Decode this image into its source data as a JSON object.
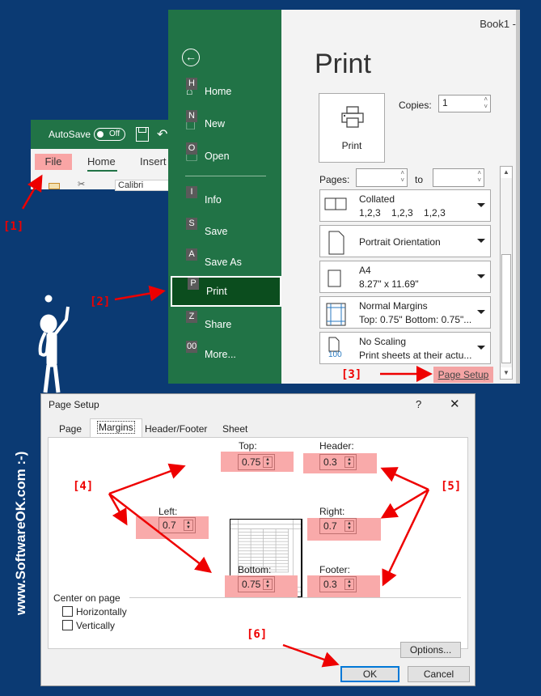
{
  "ribbon": {
    "autosave_label": "AutoSave",
    "autosave_state": "Off",
    "tabs": [
      "File",
      "Home",
      "Insert"
    ],
    "font_name": "Calibri"
  },
  "backstage": {
    "back_icon": "back-arrow-icon",
    "nav": [
      {
        "key": "H",
        "label": "Home",
        "icon": "home-icon"
      },
      {
        "key": "N",
        "label": "New",
        "icon": "new-document-icon"
      },
      {
        "key": "O",
        "label": "Open",
        "icon": "folder-icon"
      },
      {
        "key": "I",
        "label": "Info"
      },
      {
        "key": "S",
        "label": "Save"
      },
      {
        "key": "A",
        "label": "Save As"
      },
      {
        "key": "P",
        "label": "Print",
        "active": true
      },
      {
        "key": "Z",
        "label": "Share"
      },
      {
        "key": "00",
        "label": "More..."
      }
    ]
  },
  "print": {
    "window_title": "Book1 -",
    "title": "Print",
    "print_button": "Print",
    "copies_label": "Copies:",
    "copies_value": "1",
    "pages_label": "Pages:",
    "pages_from": "",
    "to_label": "to",
    "pages_to": "",
    "options": [
      {
        "line1": "Collated",
        "line2": "1,2,3    1,2,3    1,2,3"
      },
      {
        "line1": "Portrait Orientation",
        "line2": ""
      },
      {
        "line1": "A4",
        "line2": "8.27\" x 11.69\""
      },
      {
        "line1": "Normal Margins",
        "line2": "Top: 0.75\" Bottom: 0.75\"..."
      },
      {
        "line1": "No Scaling",
        "line2": "Print sheets at their actu...",
        "icon_text": "100"
      }
    ],
    "page_setup_link": "Page Setup"
  },
  "dialog": {
    "title": "Page Setup",
    "help": "?",
    "close": "✕",
    "tabs": [
      "Page",
      "Margins",
      "Header/Footer",
      "Sheet"
    ],
    "active_tab": "Margins",
    "fields": {
      "top": {
        "label": "Top:",
        "value": "0.75"
      },
      "header": {
        "label": "Header:",
        "value": "0.3"
      },
      "left": {
        "label": "Left:",
        "value": "0.7"
      },
      "right": {
        "label": "Right:",
        "value": "0.7"
      },
      "bottom": {
        "label": "Bottom:",
        "value": "0.75"
      },
      "footer": {
        "label": "Footer:",
        "value": "0.3"
      }
    },
    "center_on_page": "Center on page",
    "horizontally": "Horizontally",
    "horizontally_checked": false,
    "vertically": "Vertically",
    "vertically_checked": false,
    "options_button": "Options...",
    "ok_button": "OK",
    "cancel_button": "Cancel"
  },
  "annotations": [
    "[1]",
    "[2]",
    "[3]",
    "[4]",
    "[5]",
    "[6]"
  ],
  "watermark": "SoftwareOK.com",
  "site_text": "www.SoftwareOK.com :-)",
  "colors": {
    "excel_green": "#217346",
    "active_nav": "#0b4d1e",
    "highlight": "#f9aaaa",
    "annotation_red": "#ee0000",
    "background_blue": "#0b3a73"
  }
}
